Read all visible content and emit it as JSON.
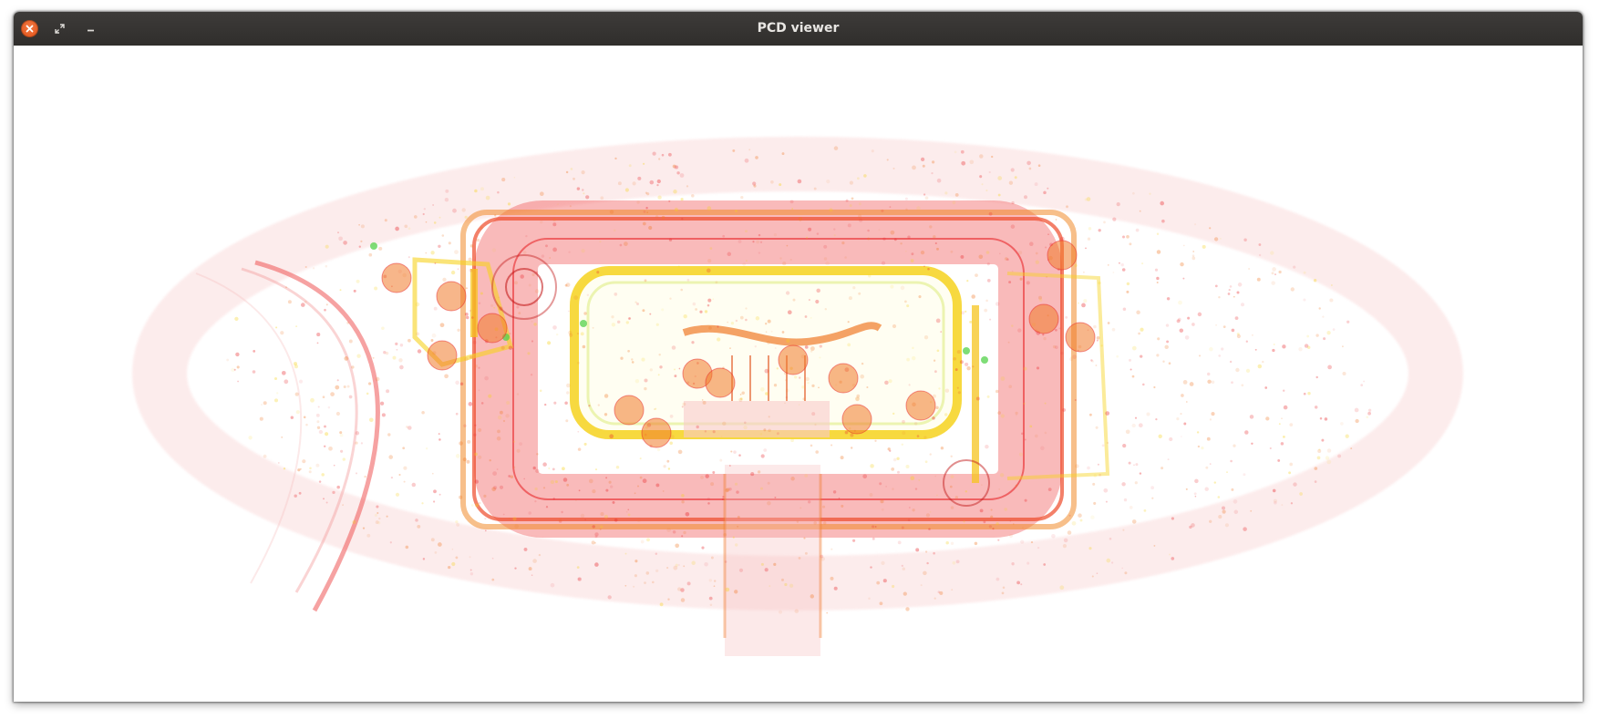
{
  "window": {
    "title": "PCD viewer",
    "controls": [
      {
        "name": "close",
        "icon": "close-icon"
      },
      {
        "name": "maximize",
        "icon": "maximize-icon"
      },
      {
        "name": "minimize",
        "icon": "minimize-icon"
      }
    ]
  },
  "viewer": {
    "background": "#ffffff",
    "colors": {
      "red": "#e8262a",
      "orange": "#f07a2a",
      "yellow": "#f6d21e",
      "green": "#53d14a"
    }
  }
}
